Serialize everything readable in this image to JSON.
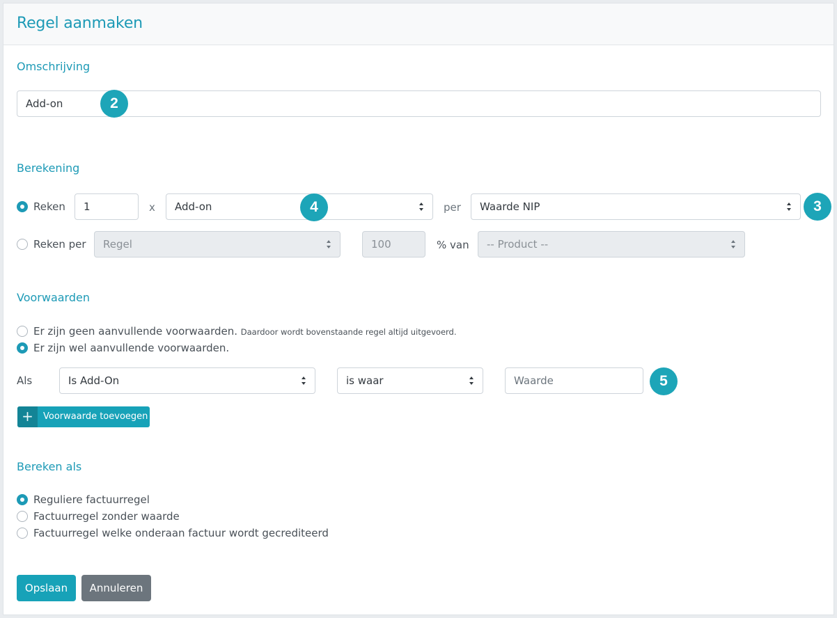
{
  "header": {
    "title": "Regel aanmaken"
  },
  "omschrijving": {
    "title": "Omschrijving",
    "value": "Add-on"
  },
  "berekening": {
    "title": "Berekening",
    "row1": {
      "radio_label": "Reken",
      "quantity": "1",
      "times": "x",
      "item_select": "Add-on",
      "per": "per",
      "per_select": "Waarde NIP"
    },
    "row2": {
      "radio_label": "Reken per",
      "unit_select": "Regel",
      "percentage": "100",
      "percent_of": "% van",
      "product_select": "-- Product --"
    }
  },
  "voorwaarden": {
    "title": "Voorwaarden",
    "option_none": "Er zijn geen aanvullende voorwaarden.",
    "option_none_note": "Daardoor wordt bovenstaande regel altijd uitgevoerd.",
    "option_some": "Er zijn wel aanvullende voorwaarden.",
    "als": "Als",
    "condition_field": "Is Add-On",
    "condition_operator": "is waar",
    "value_placeholder": "Waarde",
    "add_button": "Voorwaarde toevoegen",
    "add_icon": "+"
  },
  "bereken_als": {
    "title": "Bereken als",
    "options": [
      "Reguliere factuurregel",
      "Factuurregel zonder waarde",
      "Factuurregel welke onderaan factuur wordt gecrediteerd"
    ]
  },
  "actions": {
    "save": "Opslaan",
    "cancel": "Annuleren"
  },
  "badges": [
    "2",
    "3",
    "4",
    "5"
  ],
  "colors": {
    "accent": "#1d9ab6",
    "badge": "#1da5b8",
    "primary_button": "#17a2b8",
    "secondary_button": "#6c757d"
  }
}
